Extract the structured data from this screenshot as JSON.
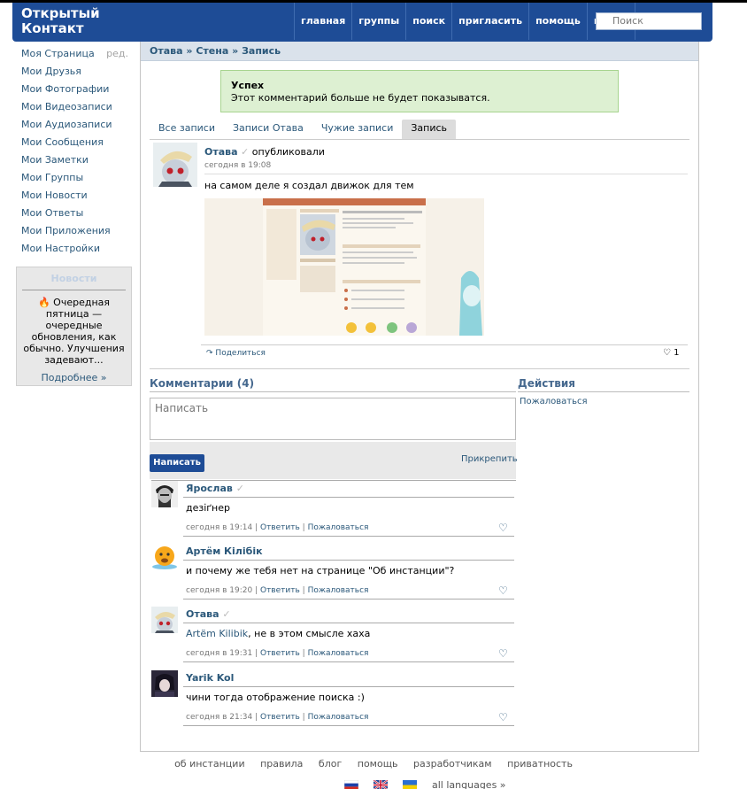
{
  "header": {
    "logo_line1": "Открытый",
    "logo_line2": "Контакт",
    "nav": [
      "главная",
      "группы",
      "поиск",
      "пригласить",
      "помощь",
      "выйти"
    ],
    "search_placeholder": "Поиск"
  },
  "sidebar": {
    "items": [
      "Моя Страница",
      "Мои Друзья",
      "Мои Фотографии",
      "Мои Видеозаписи",
      "Мои Аудиозаписи",
      "Мои Сообщения",
      "Мои Заметки",
      "Мои Группы",
      "Мои Новости",
      "Мои Ответы",
      "Мои Приложения",
      "Мои Настройки"
    ],
    "edit_label": "ред."
  },
  "news": {
    "title": "Новости",
    "text": "Очередная пятница — очередные обновления, как обычно. Улучшения задевают...",
    "more": "Подробнее »"
  },
  "breadcrumb": {
    "parts": [
      "Отава",
      "Стена",
      "Запись"
    ],
    "separator": "»"
  },
  "alert": {
    "title": "Успех",
    "message": "Этот комментарий больше не будет показыватся."
  },
  "tabs": [
    "Все записи",
    "Записи Отава",
    "Чужие записи",
    "Запись"
  ],
  "post": {
    "author": "Отава",
    "action": "опубликовали",
    "date": "сегодня в 19:08",
    "text": "на самом деле я создал движок для тем",
    "share": "Поделиться",
    "likes": "1"
  },
  "comments_section": {
    "title": "Комментарии (4)",
    "placeholder": "Написать",
    "send_button": "Написать",
    "attach": "Прикрепить"
  },
  "actions": {
    "title": "Действия",
    "report": "Пожаловаться"
  },
  "comments": [
    {
      "author": "Ярослав",
      "text": "дезіґнер",
      "date": "сегодня в 19:14",
      "reply": "Ответить",
      "report": "Пожаловаться"
    },
    {
      "author": "Артём Кілібік",
      "text": "и почему же тебя нет на странице \"Об инстанции\"?",
      "date": "сегодня в 19:20",
      "reply": "Ответить",
      "report": "Пожаловаться"
    },
    {
      "author": "Отава",
      "mention": "Artëm Kilibik",
      "text": ", не в этом смысле хаха",
      "date": "сегодня в 19:31",
      "reply": "Ответить",
      "report": "Пожаловаться"
    },
    {
      "author": "Yarik Kol",
      "text": "чини тогда отображение поиска :)",
      "date": "сегодня в 21:34",
      "reply": "Ответить",
      "report": "Пожаловаться"
    }
  ],
  "footer": {
    "links": [
      "об инстанции",
      "правила",
      "блог",
      "помощь",
      "разработчикам",
      "приватность"
    ],
    "all_languages": "all languages »"
  },
  "colors": {
    "brand": "#1e4c96",
    "link": "#2b587a",
    "success_bg": "#ddf0d2"
  }
}
